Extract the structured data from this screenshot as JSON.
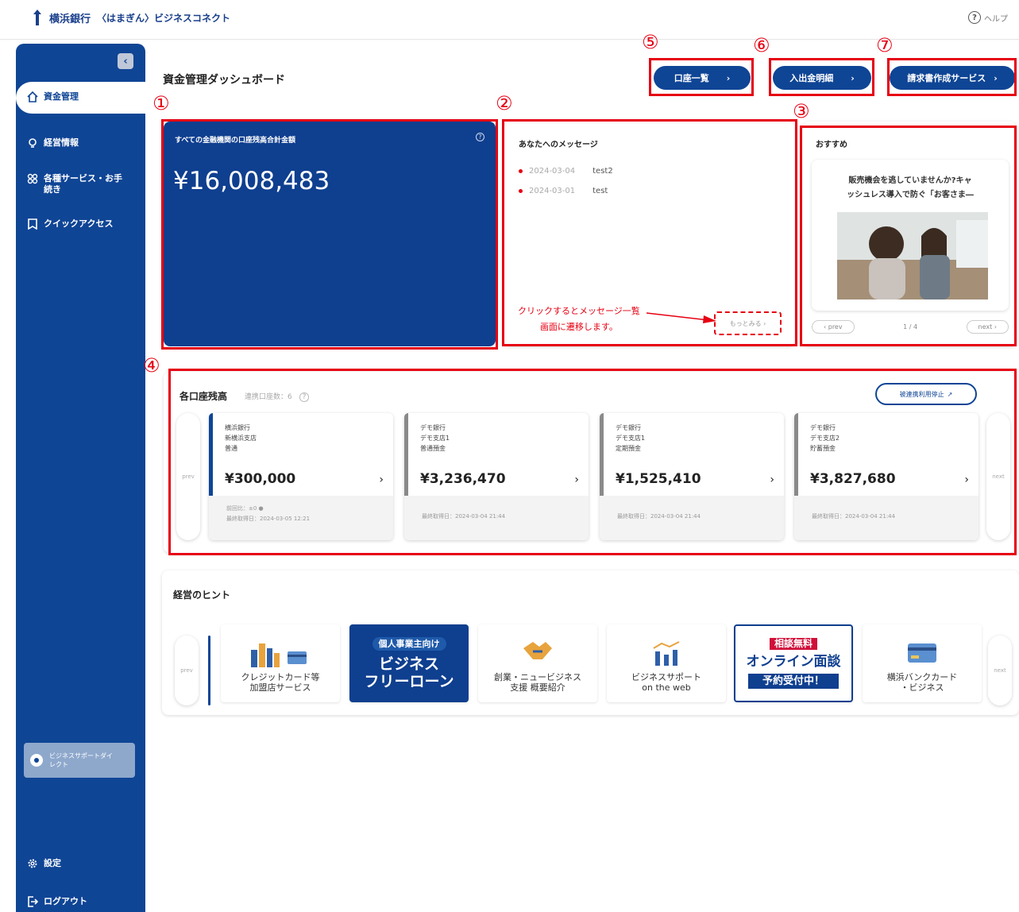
{
  "header": {
    "bank_name": "横浜銀行",
    "service_name": "〈はまぎん〉ビジネスコネクト",
    "help_label": "ヘルプ"
  },
  "sidebar": {
    "items": [
      {
        "label": "資金管理",
        "icon": "home-icon"
      },
      {
        "label": "経営情報",
        "icon": "lightbulb-icon"
      },
      {
        "label": "各種サービス・お手続き",
        "icon": "grid-icon"
      },
      {
        "label": "クイックアクセス",
        "icon": "bookmark-icon"
      }
    ],
    "support_direct": "ビジネスサポートダイレクト",
    "settings": "設定",
    "logout": "ログアウト"
  },
  "page": {
    "title": "資金管理ダッシュボード",
    "buttons": [
      "口座一覧",
      "入出金明細",
      "請求書作成サービス"
    ]
  },
  "annotations": [
    "①",
    "②",
    "③",
    "④",
    "⑤",
    "⑥",
    "⑦"
  ],
  "total_balance": {
    "label": "すべての金融機関の口座残高合計金額",
    "amount": "¥16,008,483"
  },
  "messages": {
    "title": "あなたへのメッセージ",
    "items": [
      {
        "date": "2024-03-04",
        "text": "test2"
      },
      {
        "date": "2024-03-01",
        "text": "test"
      }
    ],
    "note_line1": "クリックするとメッセージ一覧",
    "note_line2": "画面に遷移します。",
    "more_label": "もっとみる ›"
  },
  "recommend": {
    "title": "おすすめ",
    "text_line1": "販売機会を逃していませんか?キャ",
    "text_line2": "ッシュレス導入で防ぐ「お客さま―",
    "prev": "‹ prev",
    "page": "1 / 4",
    "next": "next ›"
  },
  "accounts": {
    "title": "各口座残高",
    "linked_count": "連携口座数：6",
    "stop_button": "被連携利用停止",
    "prev": "prev",
    "next": "next",
    "cards": [
      {
        "bank": "横浜銀行",
        "branch": "新横浜支店",
        "type": "普通",
        "amount": "¥300,000",
        "foot1": "前回比：±0 ●",
        "foot2": "最終取得日：2024-03-05 12:21"
      },
      {
        "bank": "デモ銀行",
        "branch": "デモ支店1",
        "type": "普通預金",
        "amount": "¥3,236,470",
        "foot1": "",
        "foot2": "最終取得日：2024-03-04 21:44"
      },
      {
        "bank": "デモ銀行",
        "branch": "デモ支店1",
        "type": "定期預金",
        "amount": "¥1,525,410",
        "foot1": "",
        "foot2": "最終取得日：2024-03-04 21:44"
      },
      {
        "bank": "デモ銀行",
        "branch": "デモ支店2",
        "type": "貯蓄預金",
        "amount": "¥3,827,680",
        "foot1": "",
        "foot2": "最終取得日：2024-03-04 21:44"
      }
    ]
  },
  "hints": {
    "title": "経営のヒント",
    "prev": "prev",
    "next": "next",
    "tiles": [
      {
        "line1": "クレジットカード等",
        "line2": "加盟店サービス"
      },
      {
        "line1": "個人事業主向け",
        "line2": "ビジネス",
        "line3": "フリーローン"
      },
      {
        "line1": "創業・ニュービジネス",
        "line2": "支援 概要紹介"
      },
      {
        "line1": "ビジネスサポート",
        "line2": "on the web"
      },
      {
        "line1": "相談無料",
        "line2": "オンライン面談",
        "line3": "予約受付中！"
      },
      {
        "line1": "横浜バンクカード",
        "line2": "・ビジネス"
      }
    ]
  },
  "colors": {
    "primary": "#0f4595",
    "annotation": "#e60012"
  }
}
